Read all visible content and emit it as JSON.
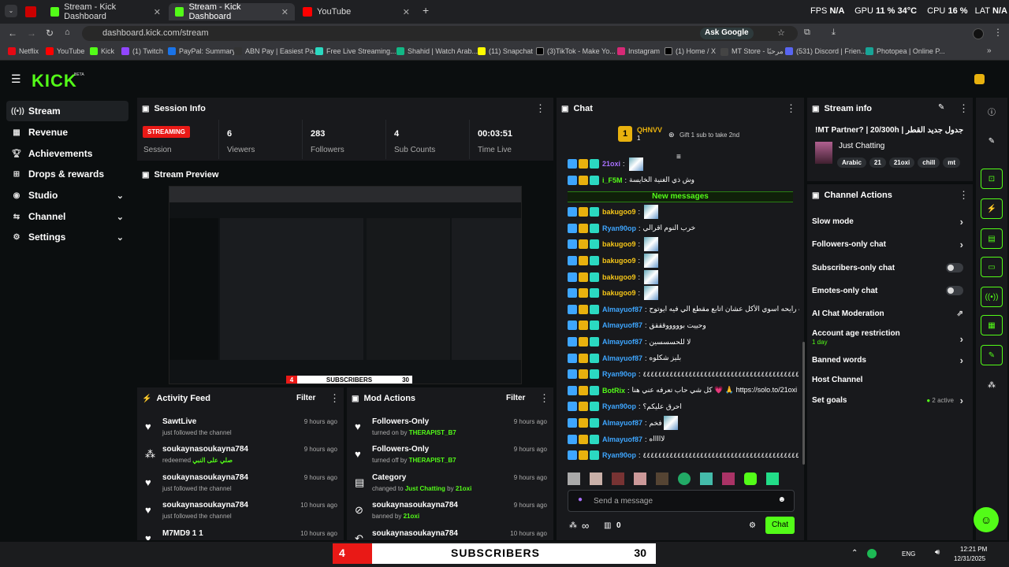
{
  "browser": {
    "tabs": [
      {
        "label": "Stream - Kick Dashboard",
        "active": false
      },
      {
        "label": "Stream - Kick Dashboard",
        "active": true
      },
      {
        "label": "YouTube",
        "active": false
      }
    ],
    "url": "dashboard.kick.com/stream",
    "ask_google": "Ask Google",
    "overlay_stats": {
      "fps_label": "FPS",
      "fps": "N/A",
      "gpu_label": "GPU",
      "gpu": "11 % 34°C",
      "cpu_label": "CPU",
      "cpu": "16 %",
      "lat_label": "LAT",
      "lat": "N/A"
    },
    "bookmarks": [
      "Netflix",
      "YouTube",
      "Kick",
      "(1) Twitch",
      "PayPal: Summary",
      "ABN Pay | Easiest Pa...",
      "Free Live Streaming...",
      "Shahid | Watch Arab...",
      "(11) Snapchat",
      "(3)TikTok - Make Yo...",
      "Instagram",
      "(1) Home / X",
      "MT Store - مرحبًا",
      "(531) Discord | Frien...",
      "Photopea | Online P..."
    ]
  },
  "logo": "KICK",
  "logo_badge": "BETA",
  "nav": [
    {
      "label": "Stream",
      "icon": "stream-icon",
      "active": true,
      "expand": false
    },
    {
      "label": "Revenue",
      "icon": "revenue-icon",
      "expand": false
    },
    {
      "label": "Achievements",
      "icon": "trophy-icon",
      "expand": false
    },
    {
      "label": "Drops & rewards",
      "icon": "gift-icon",
      "expand": false
    },
    {
      "label": "Studio",
      "icon": "studio-icon",
      "expand": true
    },
    {
      "label": "Channel",
      "icon": "channel-icon",
      "expand": true
    },
    {
      "label": "Settings",
      "icon": "gear-icon",
      "expand": true
    }
  ],
  "session": {
    "title": "Session Info",
    "status": "STREAMING",
    "status_label": "Session",
    "stats": [
      {
        "value": "6",
        "label": "Viewers"
      },
      {
        "value": "283",
        "label": "Followers"
      },
      {
        "value": "4",
        "label": "Sub Counts"
      },
      {
        "value": "00:03:51",
        "label": "Time Live"
      }
    ]
  },
  "preview": {
    "title": "Stream Preview",
    "sub_count": "4",
    "sub_label": "SUBSCRIBERS",
    "sub_goal": "30"
  },
  "activity": {
    "title": "Activity Feed",
    "filter": "Filter",
    "items": [
      {
        "name": "SawtLive",
        "desc": "just followed the channel",
        "extra": "",
        "time": "9 hours ago",
        "icon": "heart-icon"
      },
      {
        "name": "soukaynasoukayna784",
        "desc": "redeemed",
        "extra": "صلي على النبي",
        "time": "9 hours ago",
        "icon": "redeem-icon"
      },
      {
        "name": "soukaynasoukayna784",
        "desc": "just followed the channel",
        "extra": "",
        "time": "9 hours ago",
        "icon": "heart-icon"
      },
      {
        "name": "soukaynasoukayna784",
        "desc": "just followed the channel",
        "extra": "",
        "time": "10 hours ago",
        "icon": "heart-icon"
      },
      {
        "name": "M7MD9 1 1",
        "desc": "",
        "extra": "",
        "time": "10 hours ago",
        "icon": "heart-icon"
      }
    ]
  },
  "mod": {
    "title": "Mod Actions",
    "filter": "Filter",
    "items": [
      {
        "name": "Followers-Only",
        "desc": "turned on by",
        "who": "THERAPIST_B7",
        "mid": "",
        "who2": "",
        "time": "9 hours ago"
      },
      {
        "name": "Followers-Only",
        "desc": "turned off by",
        "who": "THERAPIST_B7",
        "mid": "",
        "who2": "",
        "time": "9 hours ago"
      },
      {
        "name": "Category",
        "desc": "changed to",
        "who": "Just Chatting",
        "mid": "by",
        "who2": "21oxi",
        "time": "9 hours ago"
      },
      {
        "name": "soukaynasoukayna784",
        "desc": "banned by",
        "who": "21oxi",
        "mid": "",
        "who2": "",
        "time": "9 hours ago"
      },
      {
        "name": "soukaynasoukayna784",
        "desc": "",
        "who": "",
        "mid": "",
        "who2": "",
        "time": "10 hours ago"
      }
    ]
  },
  "chat": {
    "title": "Chat",
    "gifter": "QHNVV",
    "gifter_rank": "1",
    "gifter_count": "1",
    "gift_cta": "Gift 1 sub to take 2nd",
    "new_messages": "New messages",
    "messages": [
      {
        "user": "21oxi",
        "color": "#a970ff",
        "text": "",
        "emote": true
      },
      {
        "user": "i_F5M",
        "color": "#53fc18",
        "text": "وش ذي الغنية الخايسة",
        "emote": false
      },
      {
        "user": "bakugoo9",
        "color": "#f5c518",
        "text": "",
        "emote": true
      },
      {
        "user": "Ryan90op",
        "color": "#3ea6ff",
        "text": "خرب النوم اقرالي",
        "emote": false
      },
      {
        "user": "bakugoo9",
        "color": "#f5c518",
        "text": "",
        "emote": true
      },
      {
        "user": "bakugoo9",
        "color": "#f5c518",
        "text": "",
        "emote": true
      },
      {
        "user": "bakugoo9",
        "color": "#f5c518",
        "text": "",
        "emote": true
      },
      {
        "user": "bakugoo9",
        "color": "#f5c518",
        "text": "",
        "emote": true
      },
      {
        "user": "Almayuof87",
        "color": "#3ea6ff",
        "text": "كنت رايحه اسوي الأكل عشان اتابع مقطع الي فيه ايوتوح",
        "emote": false
      },
      {
        "user": "Almayuof87",
        "color": "#3ea6ff",
        "text": "وحييت بوووووقققق",
        "emote": false
      },
      {
        "user": "Almayuof87",
        "color": "#3ea6ff",
        "text": "لا للحسسسين",
        "emote": false
      },
      {
        "user": "Almayuof87",
        "color": "#3ea6ff",
        "text": "بليز شكلوه",
        "emote": false
      },
      {
        "user": "Ryan90op",
        "color": "#3ea6ff",
        "text": "٤٤٤٤٤٤٤٤٤٤٤٤٤٤٤٤٤٤٤٤٤٤٤٤٤٤٤٤٤٤٤٤٤٤٤٤٤٤٤٤٤٤٤٤٤٤٤٤٤٤٤٤٤٤٤٤٤٤٤٤٤٤٤٤٤٤٤٤٤٤٤٤٤٤٤٤٤٤٤٤٤٤٤٤٤٤٤٤٤٤٤٤٤٤٤٤٤٤٤٤٤٤٤٤٤٤٤٤٤٤٤٤٤٤٤٤٤٤٤٤٤٤٤٤٤٤٤٤٤٤٤٤٤٤٤٤٤٤٤٤",
        "emote": false
      },
      {
        "user": "BotRix",
        "color": "#53fc18",
        "text": "كل شي حاب تعرفه عني هنا 💗 🙏 https://solo.to/21oxi",
        "emote": false
      },
      {
        "user": "Ryan90op",
        "color": "#3ea6ff",
        "text": "احرق عليكم؟",
        "emote": false
      },
      {
        "user": "Almayuof87",
        "color": "#3ea6ff",
        "text": "فخم",
        "emote": true
      },
      {
        "user": "Almayuof87",
        "color": "#3ea6ff",
        "text": "لاااااه",
        "emote": false
      },
      {
        "user": "Ryan90op",
        "color": "#3ea6ff",
        "text": "٤٤٤٤٤٤٤٤٤٤٤٤٤٤٤٤٤٤٤٤٤٤٤٤٤٤٤٤٤٤٤٤٤٤٤٤٤٤٤٤٤٤٤٤٤٤٤٤٤٤٤٤٤٤٤٤٤٤٤٤٤٤٤٤٤٤٤٤٤٤٤٤٤٤٤٤٤٤٤٤٤٤٤٤٤٤٤٤٤٤٤٤٤٤٤٤٤٤٤٤٤٤٤٤٤٤٤٤٤٤٤٤٤٤٤٤٤٤٤٤٤٤٤٤٤٤٤٤٤٤٤٤٤٤٤٤٤٤٤٤٤",
        "emote": false
      }
    ],
    "input_placeholder": "Send a message",
    "infinity": "∞",
    "points": "0",
    "send": "Chat"
  },
  "stream_info": {
    "title": "Stream info",
    "stream_title": "!MT Partner? | 20/300h | جدول جديد القطر",
    "category": "Just Chatting",
    "tags": [
      "Arabic",
      "21",
      "21oxi",
      "chill",
      "mt"
    ]
  },
  "channel_actions": {
    "title": "Channel Actions",
    "items": [
      {
        "label": "Slow mode",
        "control": "chevron",
        "sub": ""
      },
      {
        "label": "Followers-only chat",
        "control": "chevron",
        "sub": ""
      },
      {
        "label": "Subscribers-only chat",
        "control": "toggle",
        "sub": ""
      },
      {
        "label": "Emotes-only chat",
        "control": "toggle",
        "sub": ""
      },
      {
        "label": "AI Chat Moderation",
        "control": "external",
        "sub": ""
      },
      {
        "label": "Account age restriction",
        "control": "chevron",
        "sub": "1 day"
      },
      {
        "label": "Banned words",
        "control": "chevron",
        "sub": ""
      },
      {
        "label": "Host Channel",
        "control": "none",
        "sub": ""
      },
      {
        "label": "Set goals",
        "control": "chevron",
        "sub": "",
        "status": "2 active"
      }
    ]
  },
  "taskbar": {
    "time": "12:21 PM",
    "date": "12/31/2025",
    "lang": "ENG",
    "sub_count": "4",
    "sub_label": "SUBSCRIBERS",
    "sub_goal": "30"
  },
  "colors": {
    "accent": "#53fc18",
    "live": "#e91916",
    "panel": "#18191c",
    "bg": "#0b0e0f"
  }
}
